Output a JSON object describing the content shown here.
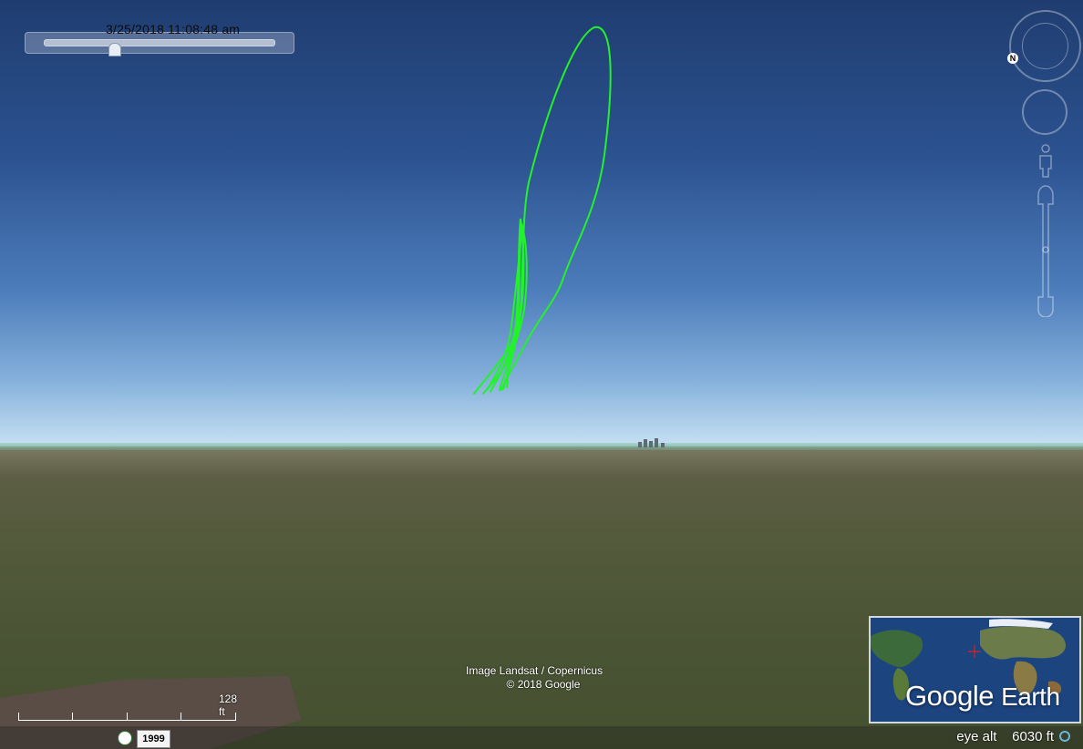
{
  "viewer": {
    "timestamp": "3/25/2018  11:08:48 am",
    "time_slider_value": 0.29
  },
  "controls": {
    "compass_north": "N"
  },
  "attribution": {
    "line1": "Image Landsat / Copernicus",
    "line2": "© 2018 Google"
  },
  "scale": {
    "label": "128 ft"
  },
  "history": {
    "year": "1999"
  },
  "status": {
    "eye_alt_label": "eye alt",
    "eye_alt_value": "6030 ft"
  },
  "overview": {
    "brand_google": "Google",
    "brand_earth": "Earth"
  },
  "colors": {
    "track": "#22f22a",
    "sky_top": "#1f3d70",
    "horizon": "#c9e2f3",
    "ground": "#4b5536"
  },
  "icons": [
    "compass-icon",
    "north-icon",
    "look-joystick-icon",
    "pegman-icon",
    "zoom-slider-icon",
    "historical-imagery-icon",
    "streaming-indicator-icon"
  ]
}
